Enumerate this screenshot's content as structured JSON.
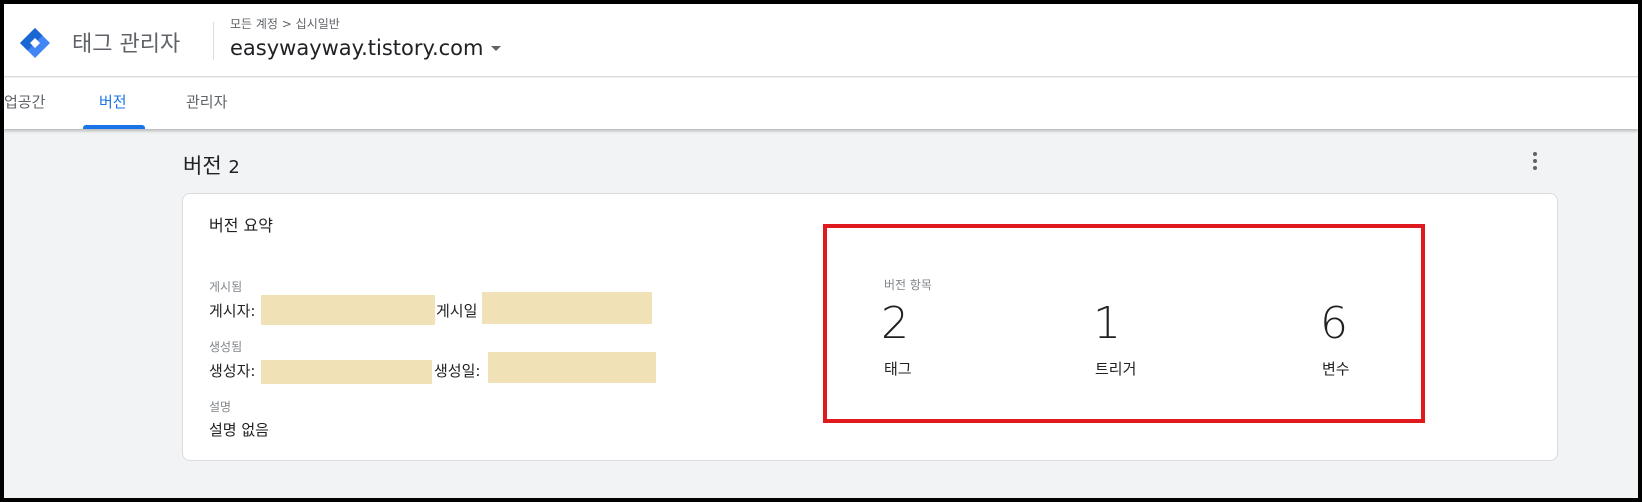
{
  "header": {
    "product_name": "태그 관리자",
    "breadcrumb": "모든 계정 > 십시일반",
    "container_name": "easywayway.tistory.com"
  },
  "tabs": [
    {
      "label": "업공간"
    },
    {
      "label": "버전"
    },
    {
      "label": "관리자"
    }
  ],
  "active_tab": "버전",
  "version": {
    "title_prefix": "버전",
    "number": "2"
  },
  "summary": {
    "title": "버전 요약",
    "published_label": "게시됨",
    "published_by_label": "게시자:",
    "published_date_label": "게시일",
    "created_label": "생성됨",
    "created_by_label": "생성자:",
    "created_date_label": "생성일:",
    "description_label": "설명",
    "description_value": "설명 없음"
  },
  "items": {
    "label": "버전 항목",
    "stats": [
      {
        "value": "2",
        "label": "태그"
      },
      {
        "value": "1",
        "label": "트리거"
      },
      {
        "value": "6",
        "label": "변수"
      }
    ]
  },
  "colors": {
    "accent": "#1a73e8",
    "highlight_border": "#e0191f",
    "redaction": "#f0e2b6",
    "logo_blue": "#4285f4",
    "logo_dark": "#1967d2"
  }
}
